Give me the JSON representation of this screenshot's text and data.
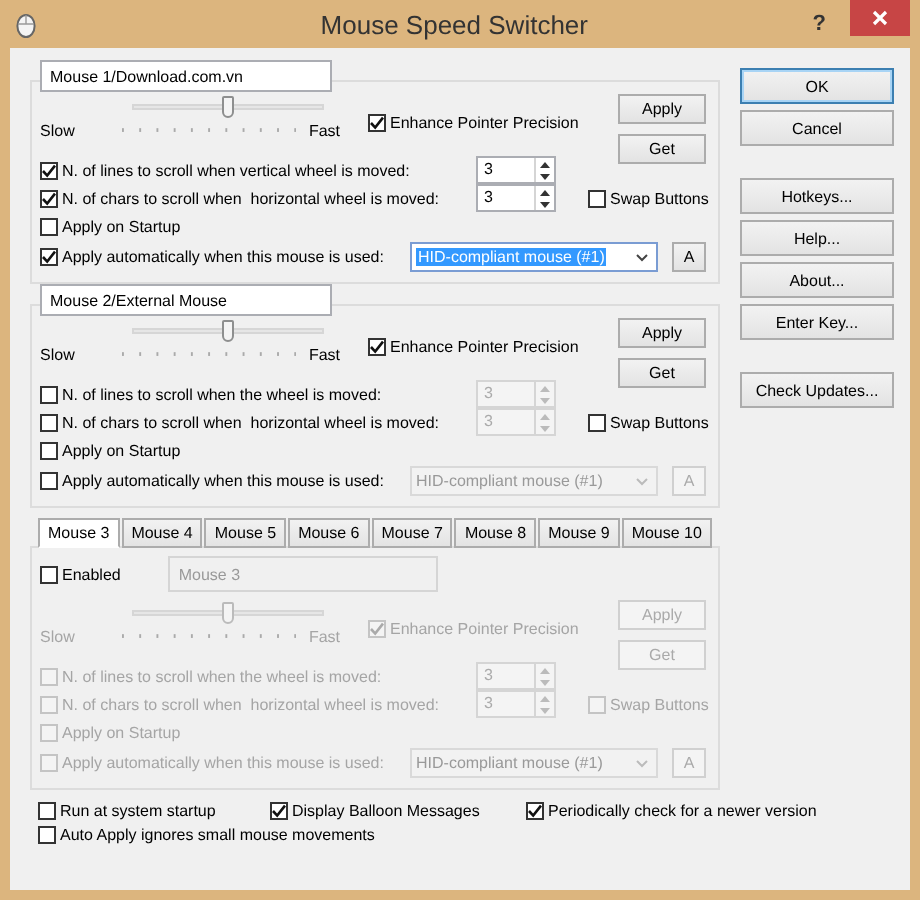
{
  "window": {
    "title": "Mouse Speed Switcher",
    "help": "?"
  },
  "mice": [
    {
      "name": "Mouse 1/Download.com.vn",
      "level": 0.5,
      "slow": "Slow",
      "fast": "Fast",
      "enhance": {
        "label": "Enhance Pointer Precision",
        "checked": true
      },
      "apply": "Apply",
      "get": "Get",
      "lines": {
        "label": "N. of lines to scroll when vertical wheel is moved:",
        "checked": true,
        "value": "3"
      },
      "chars": {
        "label": "N. of chars to scroll when  horizontal wheel is moved:",
        "checked": true,
        "value": "3"
      },
      "swap": {
        "label": "Swap Buttons",
        "checked": false
      },
      "startup": {
        "label": "Apply on Startup",
        "checked": false
      },
      "auto": {
        "label": "Apply automatically when this mouse is used:",
        "checked": true,
        "value": "HID-compliant mouse (#1)",
        "highlighted": true,
        "button": "A"
      }
    },
    {
      "name": "Mouse 2/External Mouse",
      "level": 0.5,
      "slow": "Slow",
      "fast": "Fast",
      "enhance": {
        "label": "Enhance Pointer Precision",
        "checked": true
      },
      "apply": "Apply",
      "get": "Get",
      "lines": {
        "label": "N. of lines to scroll when the wheel is moved:",
        "checked": false,
        "value": "3"
      },
      "chars": {
        "label": "N. of chars to scroll when  horizontal wheel is moved:",
        "checked": false,
        "value": "3"
      },
      "swap": {
        "label": "Swap Buttons",
        "checked": false
      },
      "startup": {
        "label": "Apply on Startup",
        "checked": false
      },
      "auto": {
        "label": "Apply automatically when this mouse is used:",
        "checked": false,
        "value": "HID-compliant mouse (#1)",
        "highlighted": false,
        "button": "A"
      }
    }
  ],
  "tab_panel": {
    "tabs": [
      {
        "label": "Mouse 3",
        "selected": true
      },
      {
        "label": "Mouse 4",
        "selected": false
      },
      {
        "label": "Mouse 5",
        "selected": false
      },
      {
        "label": "Mouse 6",
        "selected": false
      },
      {
        "label": "Mouse 7",
        "selected": false
      },
      {
        "label": "Mouse 8",
        "selected": false
      },
      {
        "label": "Mouse 9",
        "selected": false
      },
      {
        "label": "Mouse 10",
        "selected": false
      }
    ],
    "enabled": {
      "label": "Enabled",
      "checked": false
    },
    "mouse": {
      "name": "Mouse 3",
      "level": 0.5,
      "slow": "Slow",
      "fast": "Fast",
      "enhance": {
        "label": "Enhance Pointer Precision",
        "checked": true
      },
      "apply": "Apply",
      "get": "Get",
      "lines": {
        "label": "N. of lines to scroll when the wheel is moved:",
        "checked": false,
        "value": "3"
      },
      "chars": {
        "label": "N. of chars to scroll when  horizontal wheel is moved:",
        "checked": false,
        "value": "3"
      },
      "swap": {
        "label": "Swap Buttons",
        "checked": false
      },
      "startup": {
        "label": "Apply on Startup",
        "checked": false
      },
      "auto": {
        "label": "Apply automatically when this mouse is used:",
        "checked": false,
        "value": "HID-compliant mouse (#1)",
        "highlighted": false,
        "button": "A"
      }
    }
  },
  "options": [
    {
      "label": "Run at system startup",
      "checked": false
    },
    {
      "label": "Display Balloon Messages",
      "checked": true
    },
    {
      "label": "Periodically check for a newer version",
      "checked": true
    },
    {
      "label": "Auto Apply ignores small mouse movements",
      "checked": false
    }
  ],
  "side_buttons": [
    [
      "OK",
      "Cancel"
    ],
    [
      "Hotkeys...",
      "Help...",
      "About...",
      "Enter Key..."
    ],
    [
      "Check Updates..."
    ]
  ]
}
